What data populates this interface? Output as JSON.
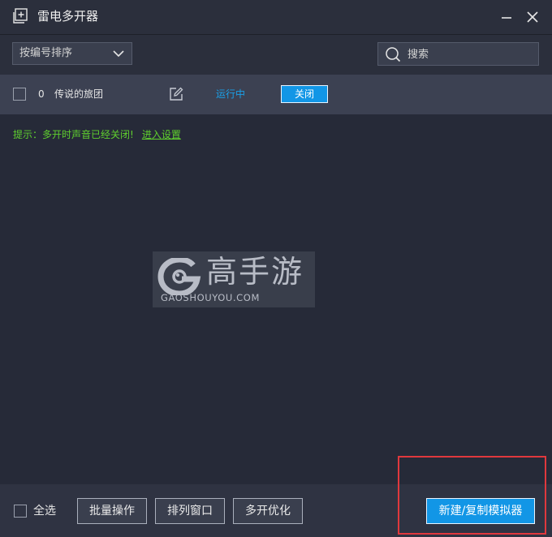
{
  "window": {
    "title": "雷电多开器"
  },
  "toolbar": {
    "sort_label": "按编号排序",
    "search_placeholder": "搜索"
  },
  "instances": [
    {
      "index": "0",
      "name": "传说的旅团",
      "status": "运行中",
      "action_label": "关闭"
    }
  ],
  "tip": {
    "text": "提示：多开时声音已经关闭!",
    "link": "进入设置"
  },
  "watermark": {
    "cn": "高手游",
    "en": "GAOSHOUYOU.COM"
  },
  "footer": {
    "select_all": "全选",
    "batch": "批量操作",
    "arrange": "排列窗口",
    "optimize": "多开优化",
    "new": "新建/复制模拟器"
  },
  "colors": {
    "accent": "#1296e6",
    "status": "#1aa0e8",
    "tip": "#5fcf2e",
    "highlight": "#e0383d"
  },
  "icons": {
    "app": "plus-window-icon",
    "minimize": "minimize-icon",
    "close": "close-icon",
    "dropdown": "chevron-down-icon",
    "search": "search-icon",
    "edit": "edit-icon"
  }
}
